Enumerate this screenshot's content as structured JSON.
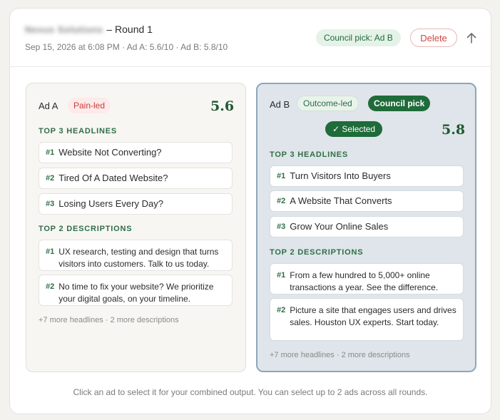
{
  "header": {
    "brand": "Nexus Solutions",
    "title": "– Round 1",
    "meta": "Sep 15, 2026 at 6:08 PM · Ad A: 5.6/10 · Ad B: 5.8/10",
    "council_badge": "Council pick: Ad B",
    "delete_label": "Delete"
  },
  "ad_a": {
    "label": "Ad A",
    "tag": "Pain-led",
    "score": "5.6",
    "headlines_label": "TOP 3 HEADLINES",
    "headlines": [
      {
        "num": "#1",
        "text": "Website Not Converting?"
      },
      {
        "num": "#2",
        "text": "Tired Of A Dated Website?"
      },
      {
        "num": "#3",
        "text": "Losing Users Every Day?"
      }
    ],
    "descriptions_label": "TOP 2 DESCRIPTIONS",
    "descriptions": [
      {
        "num": "#1",
        "text": "UX research, testing and design that turns visitors into customers. Talk to us today."
      },
      {
        "num": "#2",
        "text": "No time to fix your website? We prioritize your digital goals, on your timeline."
      }
    ],
    "more": "+7 more headlines · 2 more descriptions"
  },
  "ad_b": {
    "label": "Ad B",
    "tag": "Outcome-led",
    "council_tag": "Council pick",
    "selected": "✓ Selected",
    "score": "5.8",
    "headlines_label": "TOP 3 HEADLINES",
    "headlines": [
      {
        "num": "#1",
        "text": "Turn Visitors Into Buyers"
      },
      {
        "num": "#2",
        "text": "A Website That Converts"
      },
      {
        "num": "#3",
        "text": "Grow Your Online Sales"
      }
    ],
    "descriptions_label": "TOP 2 DESCRIPTIONS",
    "descriptions": [
      {
        "num": "#1",
        "text": "From a few hundred to 5,000+ online transactions a year. See the difference."
      },
      {
        "num": "#2",
        "text": "Picture a site that engages users and drives sales. Houston UX experts. Start today."
      }
    ],
    "more": "+7 more headlines · 2 more descriptions"
  },
  "footer": "Click an ad to select it for your combined output. You can select up to 2 ads across all rounds.",
  "icons": {
    "collapse": "arrow-up-icon"
  },
  "colors": {
    "accent_green": "#1f6b3a",
    "delete_red": "#d04545",
    "selected_card_bg": "#dfe5ea"
  }
}
